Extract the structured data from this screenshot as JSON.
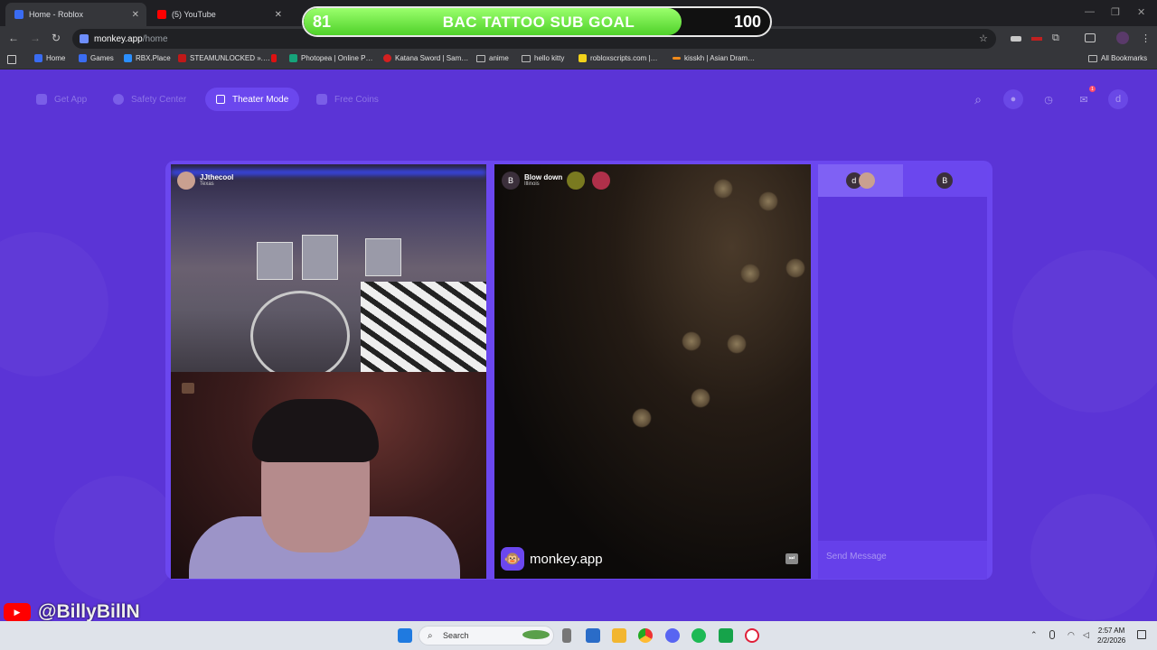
{
  "browser": {
    "tabs": [
      {
        "title": "Home - Roblox",
        "close": "✕"
      },
      {
        "title": "(5) YouTube",
        "close": "✕"
      }
    ],
    "window_controls": [
      "—",
      "❐",
      "✕"
    ],
    "url_host": "monkey.app",
    "url_path": "/home",
    "nav": {
      "back": "←",
      "forward": "→",
      "reload": "↻"
    },
    "toolbar_icons": {
      "star": "☆",
      "ext": "⧉",
      "menu": "⋮"
    },
    "bookmarks": [
      {
        "label": "Home",
        "color": "#3a6cf2"
      },
      {
        "label": "Games",
        "color": "#3a6cf2"
      },
      {
        "label": "RBX.Place",
        "color": "#2b8fff"
      },
      {
        "label": "STEAMUNLOCKED ».…",
        "color": "#c01818"
      },
      {
        "label": "",
        "color": "#d11"
      },
      {
        "label": "Photopea | Online P…",
        "color": "#16a37a"
      },
      {
        "label": "Katana Sword | Sam…",
        "color": "#d42020"
      },
      {
        "label": "anime",
        "color": "folder"
      },
      {
        "label": "hello kitty",
        "color": "folder"
      },
      {
        "label": "robloxscripts.com |…",
        "color": "#f2d21a"
      },
      {
        "label": "kisskh | Asian Dram…",
        "color": "#f08a1a"
      }
    ],
    "all_bookmarks": "All Bookmarks"
  },
  "goal_overlay": {
    "current": "81",
    "title": "BAC TATTOO SUB GOAL",
    "target": "100",
    "progress": 0.81
  },
  "site": {
    "nav_items": [
      {
        "label": "Get App"
      },
      {
        "label": "Safety Center"
      },
      {
        "label": "Theater Mode"
      },
      {
        "label": "Free Coins"
      }
    ],
    "right_icons": [
      "search-icon",
      "coins-icon",
      "history-icon",
      "chat-icon"
    ],
    "profile_initial": "d",
    "notification_dot": "1"
  },
  "video": {
    "self_user": {
      "name": "JJthecool",
      "location": "Texas"
    },
    "stranger": {
      "initial": "B",
      "name": "Blow down",
      "location": "Illinois"
    },
    "brand_text": "monkey.app",
    "brand_icon": "🐵",
    "skip": "⏭"
  },
  "chat": {
    "tab1_initial": "d",
    "tab2_initial": "B",
    "placeholder": "Send Message"
  },
  "watermark": {
    "handle": "@BillyBillN",
    "yt": "▶"
  },
  "taskbar": {
    "search_label": "Search",
    "time": "2:57 AM",
    "date": "2/2/2026"
  },
  "colors": {
    "page_bg": "#5b34d6",
    "panel": "#6b47ef",
    "goal_fill": "#4fd12a"
  }
}
